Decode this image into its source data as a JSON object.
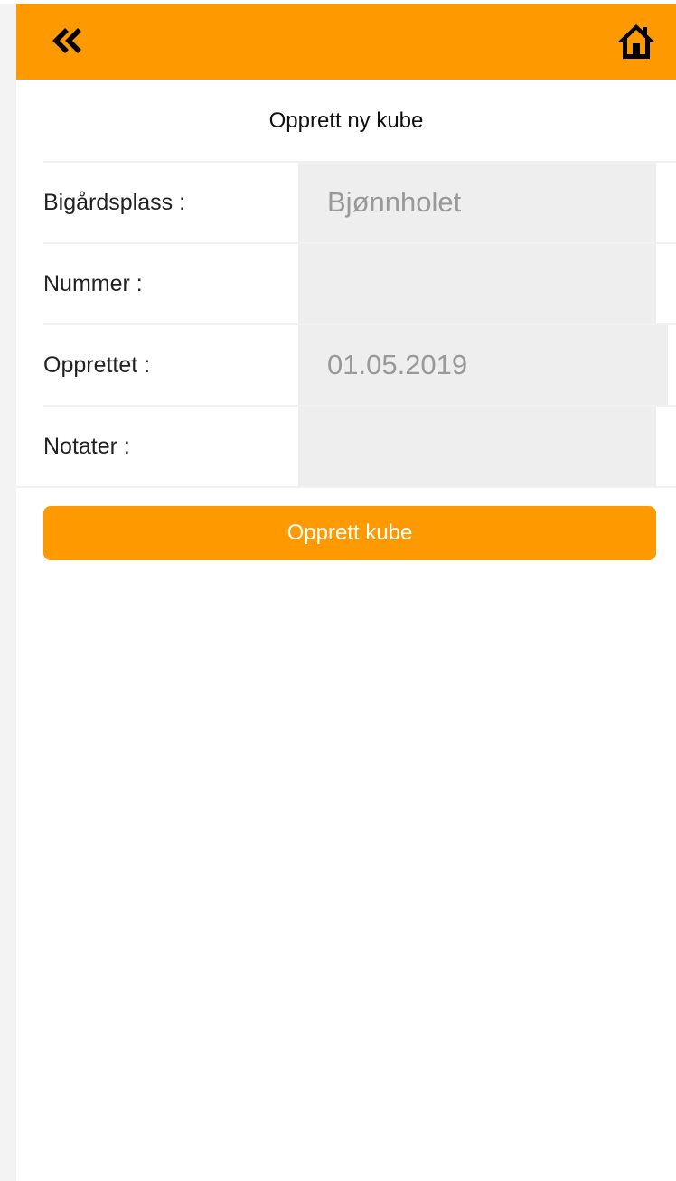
{
  "colors": {
    "accent": "#ff9900",
    "field_bg": "#eeeeee",
    "field_text": "#999999"
  },
  "header": {
    "back_icon": "double-chevron-left-icon",
    "home_icon": "home-icon"
  },
  "page": {
    "title": "Opprett ny kube"
  },
  "form": {
    "fields": [
      {
        "label": "Bigårdsplass :",
        "value": "Bjønnholet"
      },
      {
        "label": "Nummer :",
        "value": ""
      },
      {
        "label": "Opprettet :",
        "value": "01.05.2019"
      },
      {
        "label": "Notater :",
        "value": ""
      }
    ]
  },
  "actions": {
    "submit_label": "Opprett kube"
  }
}
